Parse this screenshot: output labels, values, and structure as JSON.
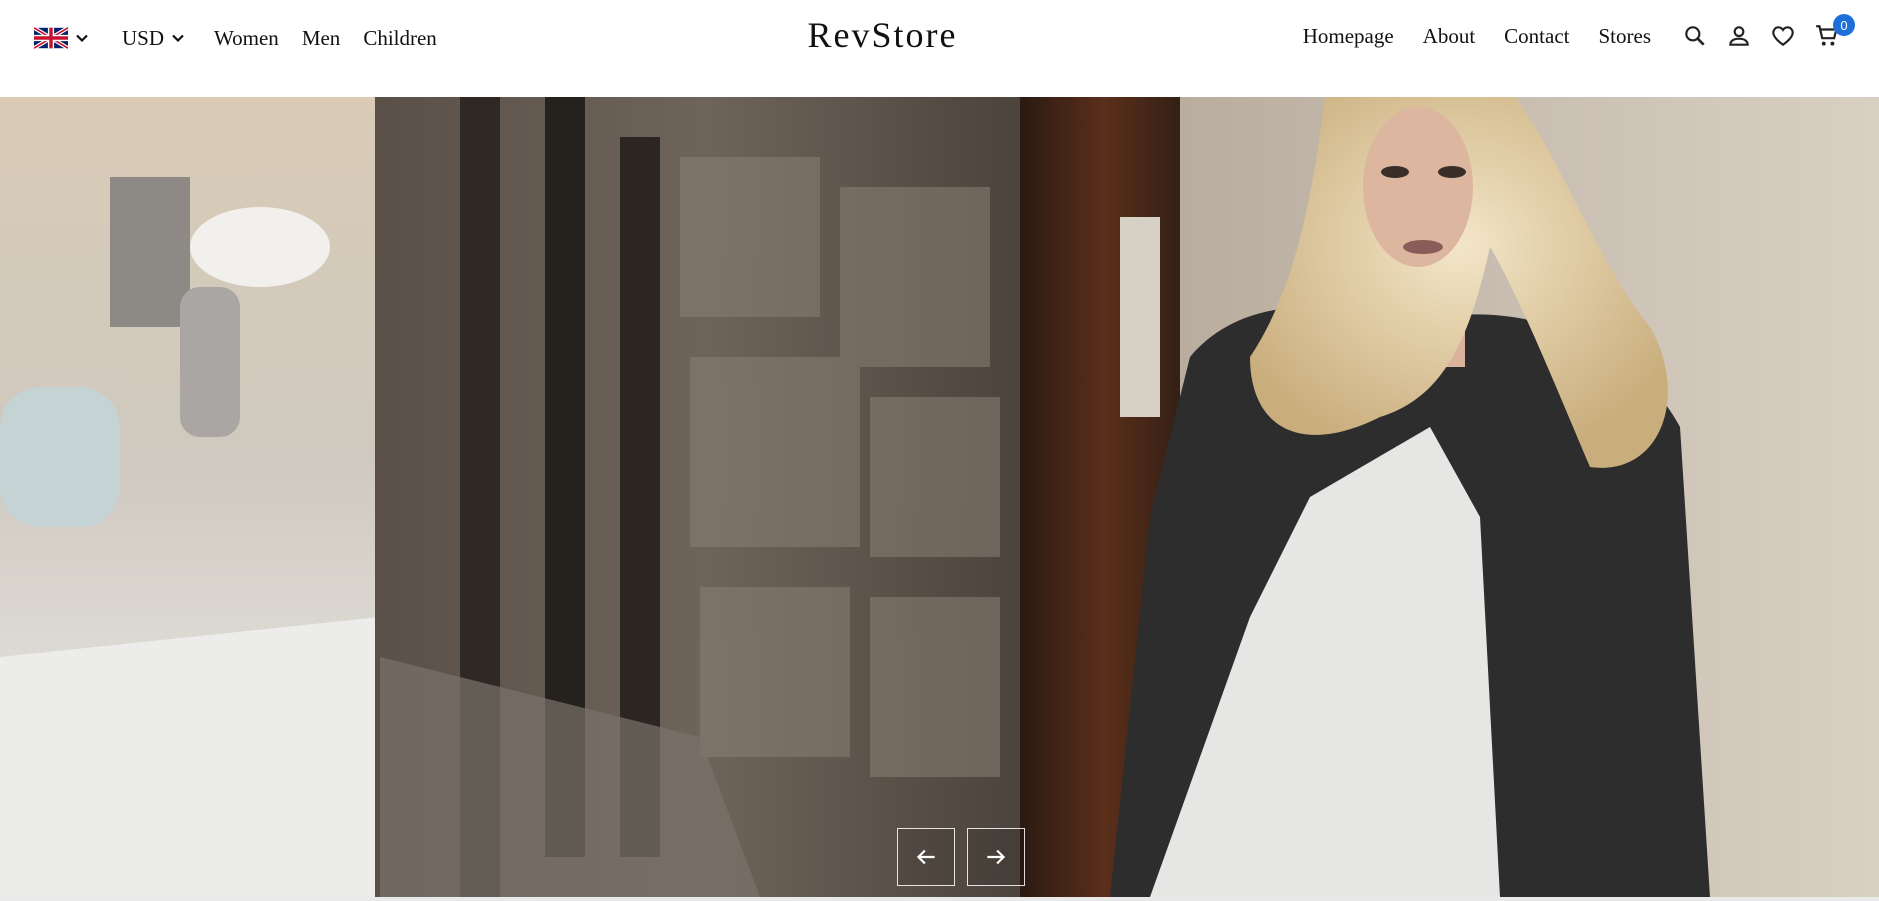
{
  "header": {
    "language": {
      "icon": "uk-flag-icon",
      "selected": "English"
    },
    "currency": {
      "selected": "USD"
    },
    "left_nav": [
      {
        "label": "Women"
      },
      {
        "label": "Men"
      },
      {
        "label": "Children"
      }
    ],
    "brand": "RevStore",
    "right_nav": [
      {
        "label": "Homepage"
      },
      {
        "label": "About"
      },
      {
        "label": "Contact"
      },
      {
        "label": "Stores"
      }
    ],
    "icons": [
      "search-icon",
      "user-icon",
      "heart-icon",
      "cart-icon"
    ],
    "cart_count": "0",
    "accent_color": "#1e6fd9"
  },
  "hero": {
    "image": "fashion-model-street-photo",
    "controls": [
      "arrow-left-icon",
      "arrow-right-icon"
    ]
  }
}
